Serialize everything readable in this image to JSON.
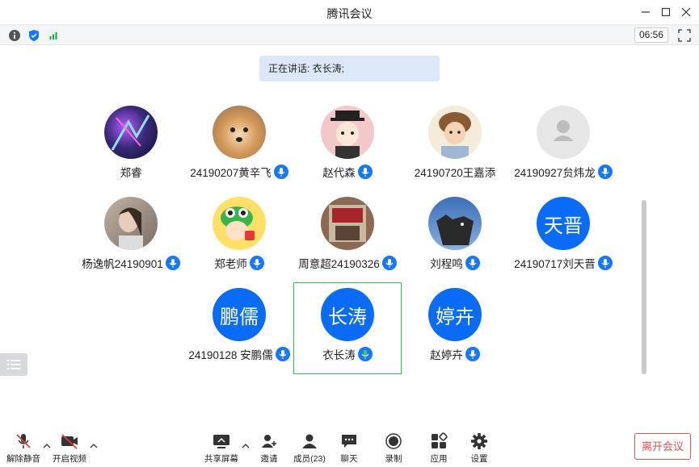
{
  "window": {
    "title": "腾讯会议"
  },
  "topbar": {
    "timer": "06:56"
  },
  "speaking_banner": "正在讲话: 衣长涛;",
  "participants": [
    {
      "name": "郑睿",
      "avatar": "photo",
      "mic": false
    },
    {
      "name": "24190207黄辛飞",
      "avatar": "photo",
      "mic": true
    },
    {
      "name": "赵代森",
      "avatar": "photo",
      "mic": true
    },
    {
      "name": "24190720王嘉添",
      "avatar": "photo",
      "mic": false
    },
    {
      "name": "24190927贠炜龙",
      "avatar": "default",
      "mic": true
    },
    {
      "name": "杨逸帆24190901",
      "avatar": "photo",
      "mic": true
    },
    {
      "name": "郑老师",
      "avatar": "photo",
      "mic": true
    },
    {
      "name": "周意超24190326",
      "avatar": "photo",
      "mic": true
    },
    {
      "name": "刘程鸣",
      "avatar": "photo",
      "mic": true
    },
    {
      "name": "24190717刘天晋",
      "avatar_text": "天晋",
      "mic": true
    },
    {
      "name": "24190128 安鹏儒",
      "avatar_text": "鹏儒",
      "mic": true
    },
    {
      "name": "衣长涛",
      "avatar_text": "长涛",
      "mic": true,
      "speaking": true
    },
    {
      "name": "赵婷卉",
      "avatar_text": "婷卉",
      "mic": true
    }
  ],
  "bottom": {
    "unmute": "解除静音",
    "start_video": "开启视频",
    "share_screen": "共享屏幕",
    "invite": "邀请",
    "members": "成员(23)",
    "chat": "聊天",
    "record": "录制",
    "apps": "应用",
    "settings": "设置",
    "leave": "离开会议"
  },
  "colors": {
    "accent": "#0a6cf5",
    "speaking_border": "#22c55e",
    "leave": "#e15252"
  }
}
